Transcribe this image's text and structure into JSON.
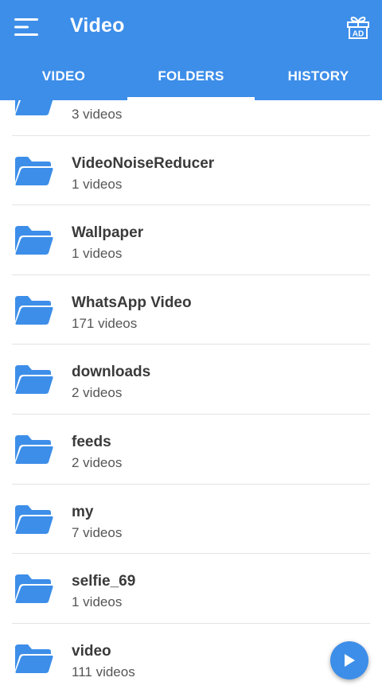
{
  "appbar": {
    "title": "Video",
    "menu_icon": "hamburger-menu-icon",
    "gift_icon": "gift-ad-icon",
    "gift_badge": "AD"
  },
  "tabs": [
    {
      "label": "VIDEO",
      "active": false
    },
    {
      "label": "FOLDERS",
      "active": true
    },
    {
      "label": "HISTORY",
      "active": false
    }
  ],
  "folders": [
    {
      "name": "",
      "count": "3 videos"
    },
    {
      "name": "VideoNoiseReducer",
      "count": "1 videos"
    },
    {
      "name": "Wallpaper",
      "count": "1 videos"
    },
    {
      "name": "WhatsApp Video",
      "count": "171 videos"
    },
    {
      "name": "downloads",
      "count": "2 videos"
    },
    {
      "name": "feeds",
      "count": "2 videos"
    },
    {
      "name": "my",
      "count": "7 videos"
    },
    {
      "name": "selfie_69",
      "count": "1 videos"
    },
    {
      "name": "video",
      "count": "111 videos"
    }
  ],
  "fab": {
    "icon": "play-icon"
  },
  "colors": {
    "primary": "#3d8ee9",
    "folder": "#3d8ee9"
  }
}
